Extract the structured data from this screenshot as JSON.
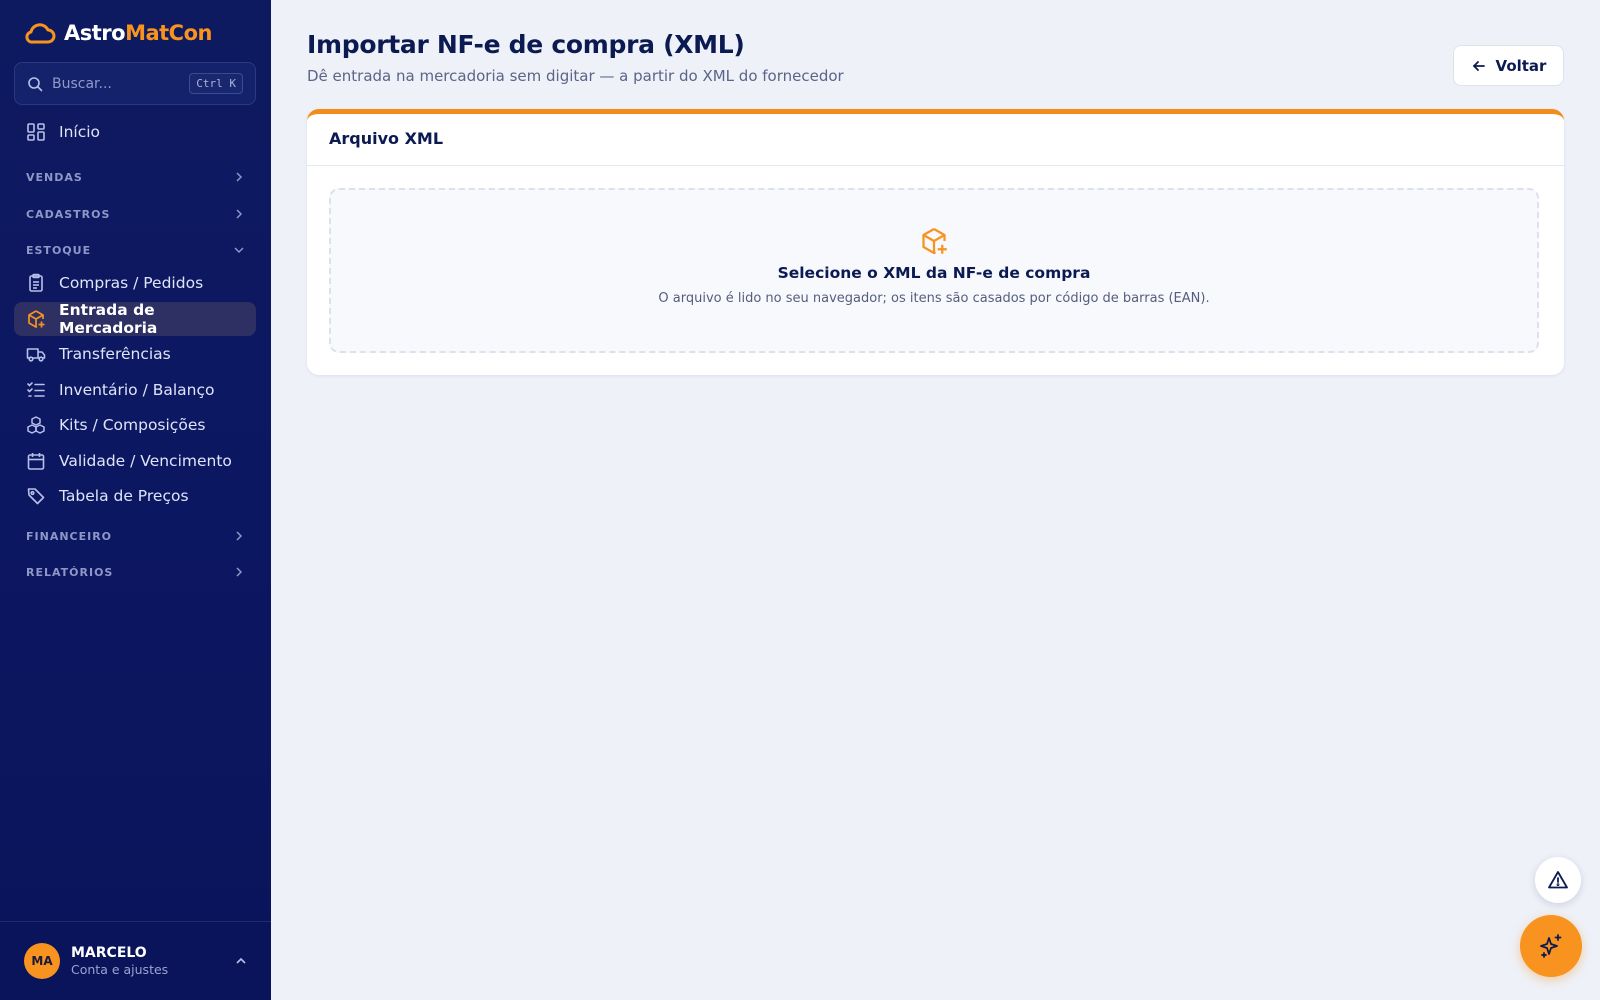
{
  "brand": {
    "part1": "Astro",
    "part2": "MatCon"
  },
  "search": {
    "placeholder": "Buscar...",
    "shortcut": "Ctrl K"
  },
  "nav": {
    "home": "Início",
    "sections": {
      "vendas": "VENDAS",
      "cadastros": "CADASTROS",
      "estoque": "ESTOQUE",
      "financeiro": "FINANCEIRO",
      "relatorios": "RELATÓRIOS"
    },
    "estoque_items": [
      {
        "label": "Compras / Pedidos",
        "icon": "clipboard-icon"
      },
      {
        "label": "Entrada de Mercadoria",
        "icon": "package-plus-icon",
        "active": true
      },
      {
        "label": "Transferências",
        "icon": "truck-icon"
      },
      {
        "label": "Inventário / Balanço",
        "icon": "checklist-icon"
      },
      {
        "label": "Kits / Composições",
        "icon": "boxes-icon"
      },
      {
        "label": "Validade / Vencimento",
        "icon": "calendar-icon"
      },
      {
        "label": "Tabela de Preços",
        "icon": "tag-icon"
      }
    ]
  },
  "user": {
    "initials": "MA",
    "name": "MARCELO",
    "subtitle": "Conta e ajustes"
  },
  "page": {
    "title": "Importar NF-e de compra (XML)",
    "subtitle": "Dê entrada na mercadoria sem digitar — a partir do XML do fornecedor",
    "back_label": "Voltar"
  },
  "card": {
    "title": "Arquivo XML",
    "dropzone_title": "Selecione o XML da NF-e de compra",
    "dropzone_subtitle": "O arquivo é lido no seu navegador; os itens são casados por código de barras (EAN)."
  },
  "colors": {
    "accent": "#f7931e",
    "sidebar": "#0c1762",
    "background": "#eef1f8"
  }
}
